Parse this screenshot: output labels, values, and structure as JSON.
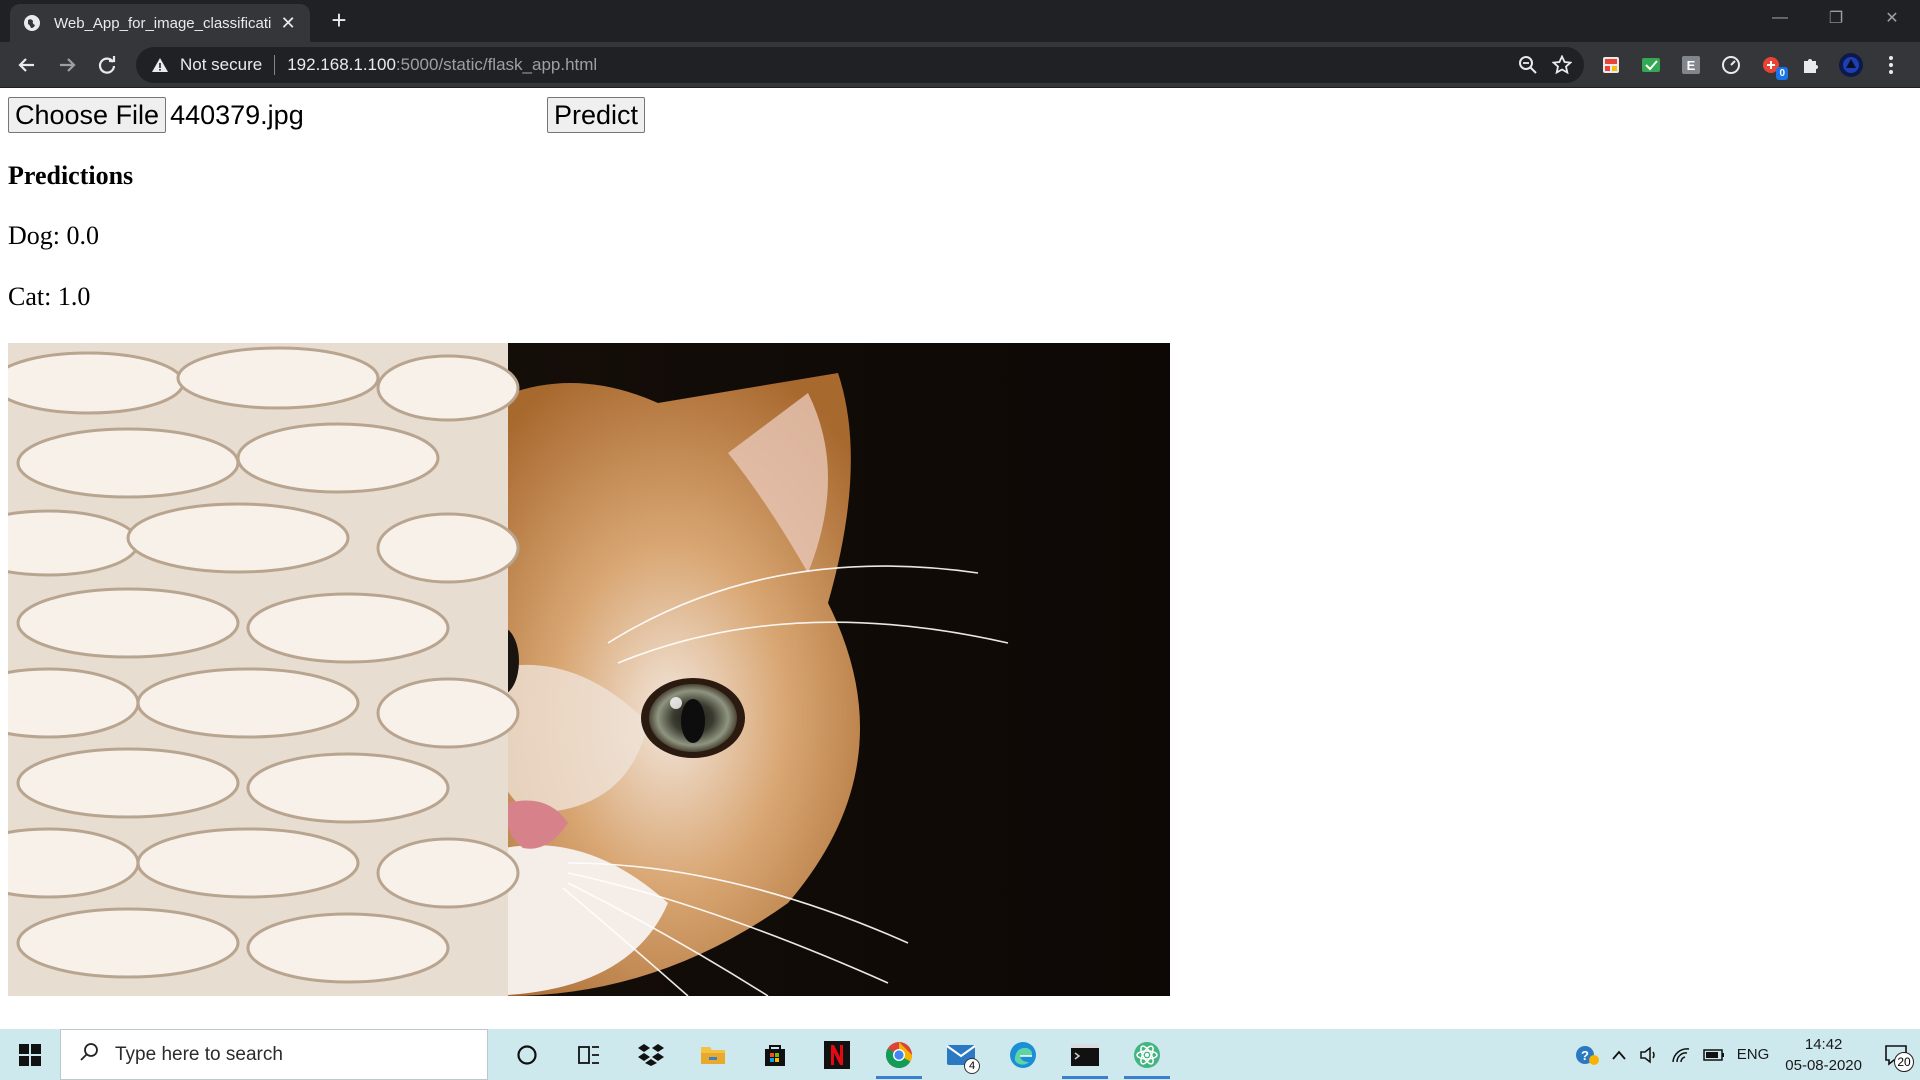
{
  "browser": {
    "tab_title": "Web_App_for_image_classificatio",
    "omnibox": {
      "security_label": "Not secure",
      "url_host": "192.168.1.100",
      "url_path": ":5000/static/flask_app.html"
    },
    "extensions": [
      {
        "name": "ext-red-icon"
      },
      {
        "name": "ext-green-check-icon"
      },
      {
        "name": "ext-e-icon",
        "text": "E"
      },
      {
        "name": "ext-speed-icon"
      },
      {
        "name": "ext-red-badge-icon",
        "badge": "0"
      },
      {
        "name": "puzzle-icon"
      },
      {
        "name": "profile-avatar-icon"
      }
    ]
  },
  "page": {
    "choose_file_label": "Choose File",
    "file_name": "440379.jpg",
    "predict_label": "Predict",
    "predictions_heading": "Predictions",
    "predictions": [
      {
        "label": "Dog",
        "text": "Dog: 0.0"
      },
      {
        "label": "Cat",
        "text": "Cat: 1.0"
      }
    ]
  },
  "taskbar": {
    "search_placeholder": "Type here to search",
    "mail_badge": "4",
    "language": "ENG",
    "time": "14:42",
    "date": "05-08-2020",
    "notification_count": "20"
  }
}
